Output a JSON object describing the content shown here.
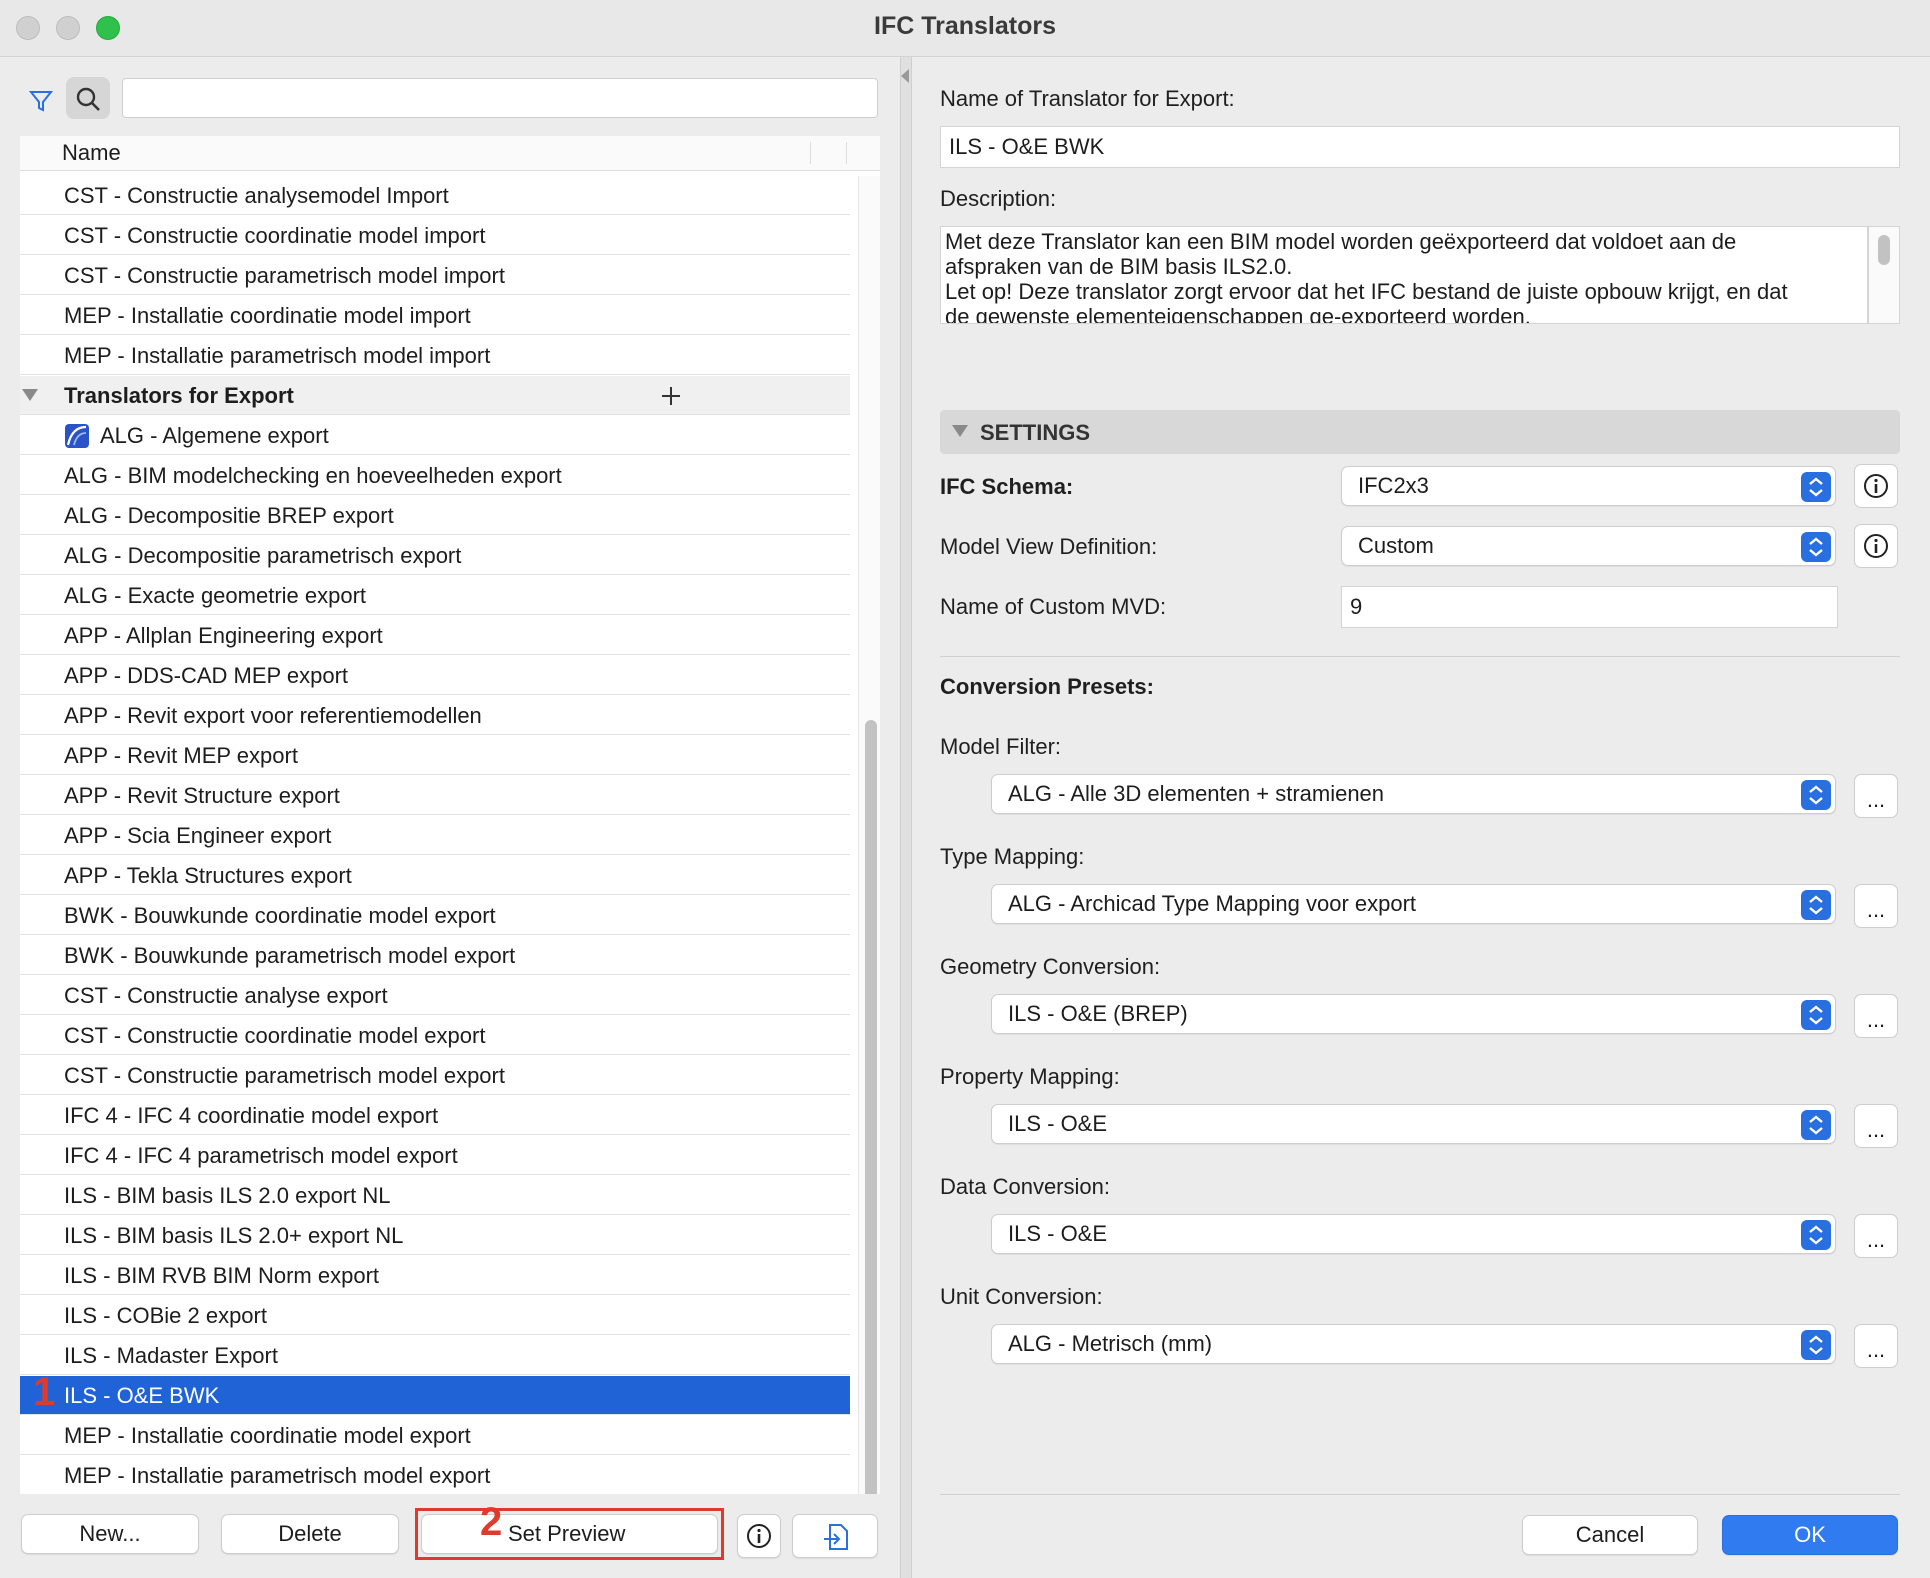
{
  "window": {
    "title": "IFC Translators"
  },
  "search": {
    "placeholder": ""
  },
  "list": {
    "column_name": "Name",
    "import_items": [
      "CST - Constructie analysemodel Import",
      "CST - Constructie coordinatie model import",
      "CST - Constructie parametrisch model import",
      "MEP - Installatie coordinatie model import",
      "MEP - Installatie parametrisch model import"
    ],
    "export_group": "Translators for Export",
    "export_items": [
      "ALG - Algemene export",
      "ALG - BIM modelchecking en hoeveelheden export",
      "ALG - Decompositie BREP export",
      "ALG - Decompositie parametrisch export",
      "ALG - Exacte geometrie export",
      "APP - Allplan Engineering export",
      "APP - DDS-CAD MEP export",
      "APP - Revit export voor referentiemodellen",
      "APP - Revit MEP export",
      "APP - Revit Structure export",
      "APP - Scia Engineer export",
      "APP - Tekla Structures export",
      "BWK - Bouwkunde coordinatie model export",
      "BWK - Bouwkunde parametrisch model export",
      "CST - Constructie analyse export",
      "CST - Constructie coordinatie model export",
      "CST - Constructie parametrisch model export",
      "IFC 4 - IFC 4 coordinatie model export",
      "IFC 4 - IFC 4 parametrisch model export",
      "ILS - BIM basis ILS 2.0 export NL",
      "ILS - BIM basis ILS 2.0+ export NL",
      "ILS - BIM RVB BIM Norm export",
      "ILS - COBie 2 export",
      "ILS - Madaster Export",
      "ILS - O&E BWK",
      "MEP - Installatie coordinatie model export",
      "MEP - Installatie parametrisch model export"
    ],
    "selected_index": 24
  },
  "bottom_left": {
    "new": "New...",
    "delete": "Delete",
    "set_preview": "Set Preview"
  },
  "badges": {
    "one": "1",
    "two": "2"
  },
  "right": {
    "name_label": "Name of Translator for Export:",
    "name_value": "ILS - O&E BWK",
    "desc_label": "Description:",
    "desc_lines": [
      "Met deze Translator kan een BIM model worden geëxporteerd dat voldoet aan de",
      "afspraken van de BIM basis ILS2.0.",
      "Let op! Deze translator zorgt ervoor dat het IFC bestand de juiste opbouw krijgt, en dat",
      "de gewenste elementeigenschappen ge-exporteerd worden."
    ],
    "settings_title": "SETTINGS",
    "schema_label": "IFC Schema:",
    "schema_value": "IFC2x3",
    "mvd_label": "Model View Definition:",
    "mvd_value": "Custom",
    "custom_mvd_label": "Name of Custom MVD:",
    "custom_mvd_value": "9",
    "presets_title": "Conversion Presets:",
    "model_filter_label": "Model Filter:",
    "model_filter_value": "ALG - Alle 3D elementen + stramienen",
    "type_mapping_label": "Type Mapping:",
    "type_mapping_value": "ALG - Archicad Type Mapping voor export",
    "geometry_label": "Geometry Conversion:",
    "geometry_value": "ILS - O&E (BREP)",
    "property_label": "Property Mapping:",
    "property_value": "ILS - O&E",
    "data_label": "Data Conversion:",
    "data_value": "ILS - O&E",
    "unit_label": "Unit Conversion:",
    "unit_value": "ALG - Metrisch (mm)",
    "ellipsis": "...",
    "cancel": "Cancel",
    "ok": "OK"
  },
  "colors": {
    "accent": "#1f63d6",
    "badge_red": "#e03a2c",
    "ok_button": "#2f7bef"
  }
}
